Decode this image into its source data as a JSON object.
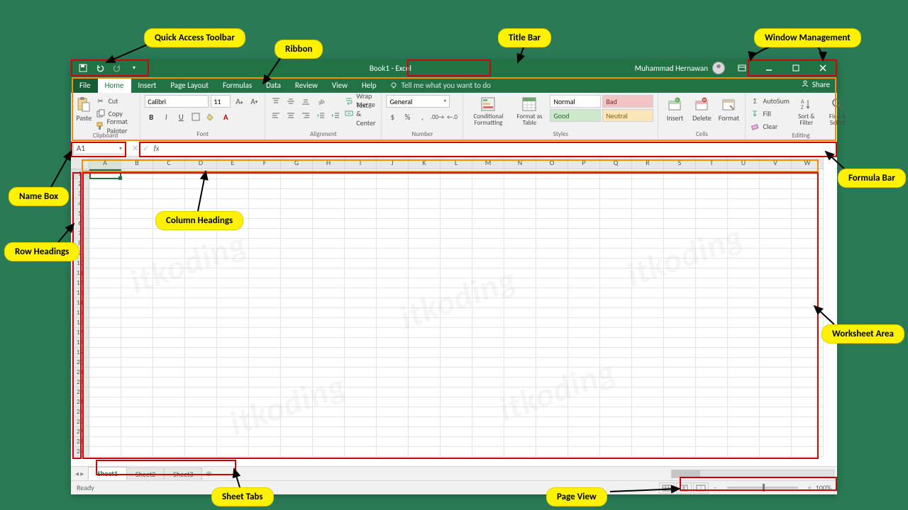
{
  "callouts": {
    "qat": "Quick Access Toolbar",
    "ribbon": "Ribbon",
    "titlebar": "Title Bar",
    "winmgmt": "Window Management",
    "namebox": "Name Box",
    "colheads": "Column Headings",
    "rowheads": "Row Headings",
    "formulabar": "Formula Bar",
    "worksheet": "Worksheet Area",
    "sheettabs": "Sheet Tabs",
    "pageview": "Page View"
  },
  "title": {
    "book": "Book1",
    "sep": "  -  ",
    "app": "Excel"
  },
  "user": {
    "name": "Muhammad Hernawan"
  },
  "tabs": {
    "file": "File",
    "home": "Home",
    "insert": "Insert",
    "pagelayout": "Page Layout",
    "formulas": "Formulas",
    "data": "Data",
    "review": "Review",
    "view": "View",
    "help": "Help",
    "tellme": "Tell me what you want to do",
    "share": "Share"
  },
  "ribbon": {
    "clipboard": {
      "label": "Clipboard",
      "paste": "Paste",
      "cut": "Cut",
      "copy": "Copy",
      "painter": "Format Painter"
    },
    "font": {
      "label": "Font",
      "name": "Calibri",
      "size": "11",
      "b": "B",
      "i": "I",
      "u": "U"
    },
    "alignment": {
      "label": "Alignment",
      "wrap": "Wrap Text",
      "merge": "Merge & Center"
    },
    "number": {
      "label": "Number",
      "format": "General",
      "currency": "$",
      "percent": "%",
      "comma": ","
    },
    "styles": {
      "label": "Styles",
      "cond": "Conditional\nFormatting",
      "fmttable": "Format as\nTable",
      "normal": "Normal",
      "bad": "Bad",
      "good": "Good",
      "neutral": "Neutral"
    },
    "cells": {
      "label": "Cells",
      "insert": "Insert",
      "delete": "Delete",
      "format": "Format"
    },
    "editing": {
      "label": "Editing",
      "autosum": "AutoSum",
      "fill": "Fill",
      "clear": "Clear",
      "sort": "Sort &\nFilter",
      "find": "Find &\nSelect"
    }
  },
  "namebox": "A1",
  "formula_fx": "fx",
  "columns": [
    "A",
    "B",
    "C",
    "D",
    "E",
    "F",
    "G",
    "H",
    "I",
    "J",
    "K",
    "L",
    "M",
    "N",
    "O",
    "P",
    "Q",
    "R",
    "S",
    "T",
    "U",
    "V",
    "W"
  ],
  "rows": [
    "1",
    "2",
    "3",
    "4",
    "5",
    "6",
    "7",
    "8",
    "9",
    "10",
    "11",
    "12",
    "13",
    "14",
    "15",
    "16",
    "17",
    "18",
    "19",
    "20",
    "21",
    "22",
    "23",
    "24",
    "25",
    "26",
    "27",
    "28",
    "29"
  ],
  "sheets": {
    "s1": "Sheet1",
    "s2": "Sheet2",
    "s3": "Sheet3"
  },
  "status": {
    "ready": "Ready",
    "zoom": "100%"
  }
}
